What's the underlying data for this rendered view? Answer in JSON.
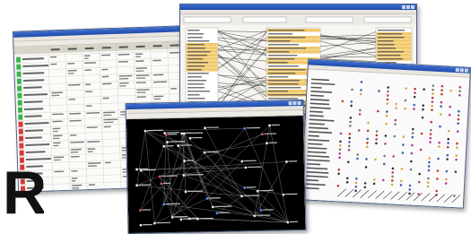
{
  "logo": {
    "letter": "R"
  },
  "colors": {
    "titlebar": "#2856b8",
    "highlight_yellow": "#f2c96b",
    "status_green": "#39b54a",
    "status_red": "#d63b3b",
    "network_bg": "#000000"
  },
  "windows": [
    {
      "id": "spreadsheet-window"
    },
    {
      "id": "list-link-window"
    },
    {
      "id": "network-graph-window"
    },
    {
      "id": "dot-matrix-window"
    }
  ]
}
